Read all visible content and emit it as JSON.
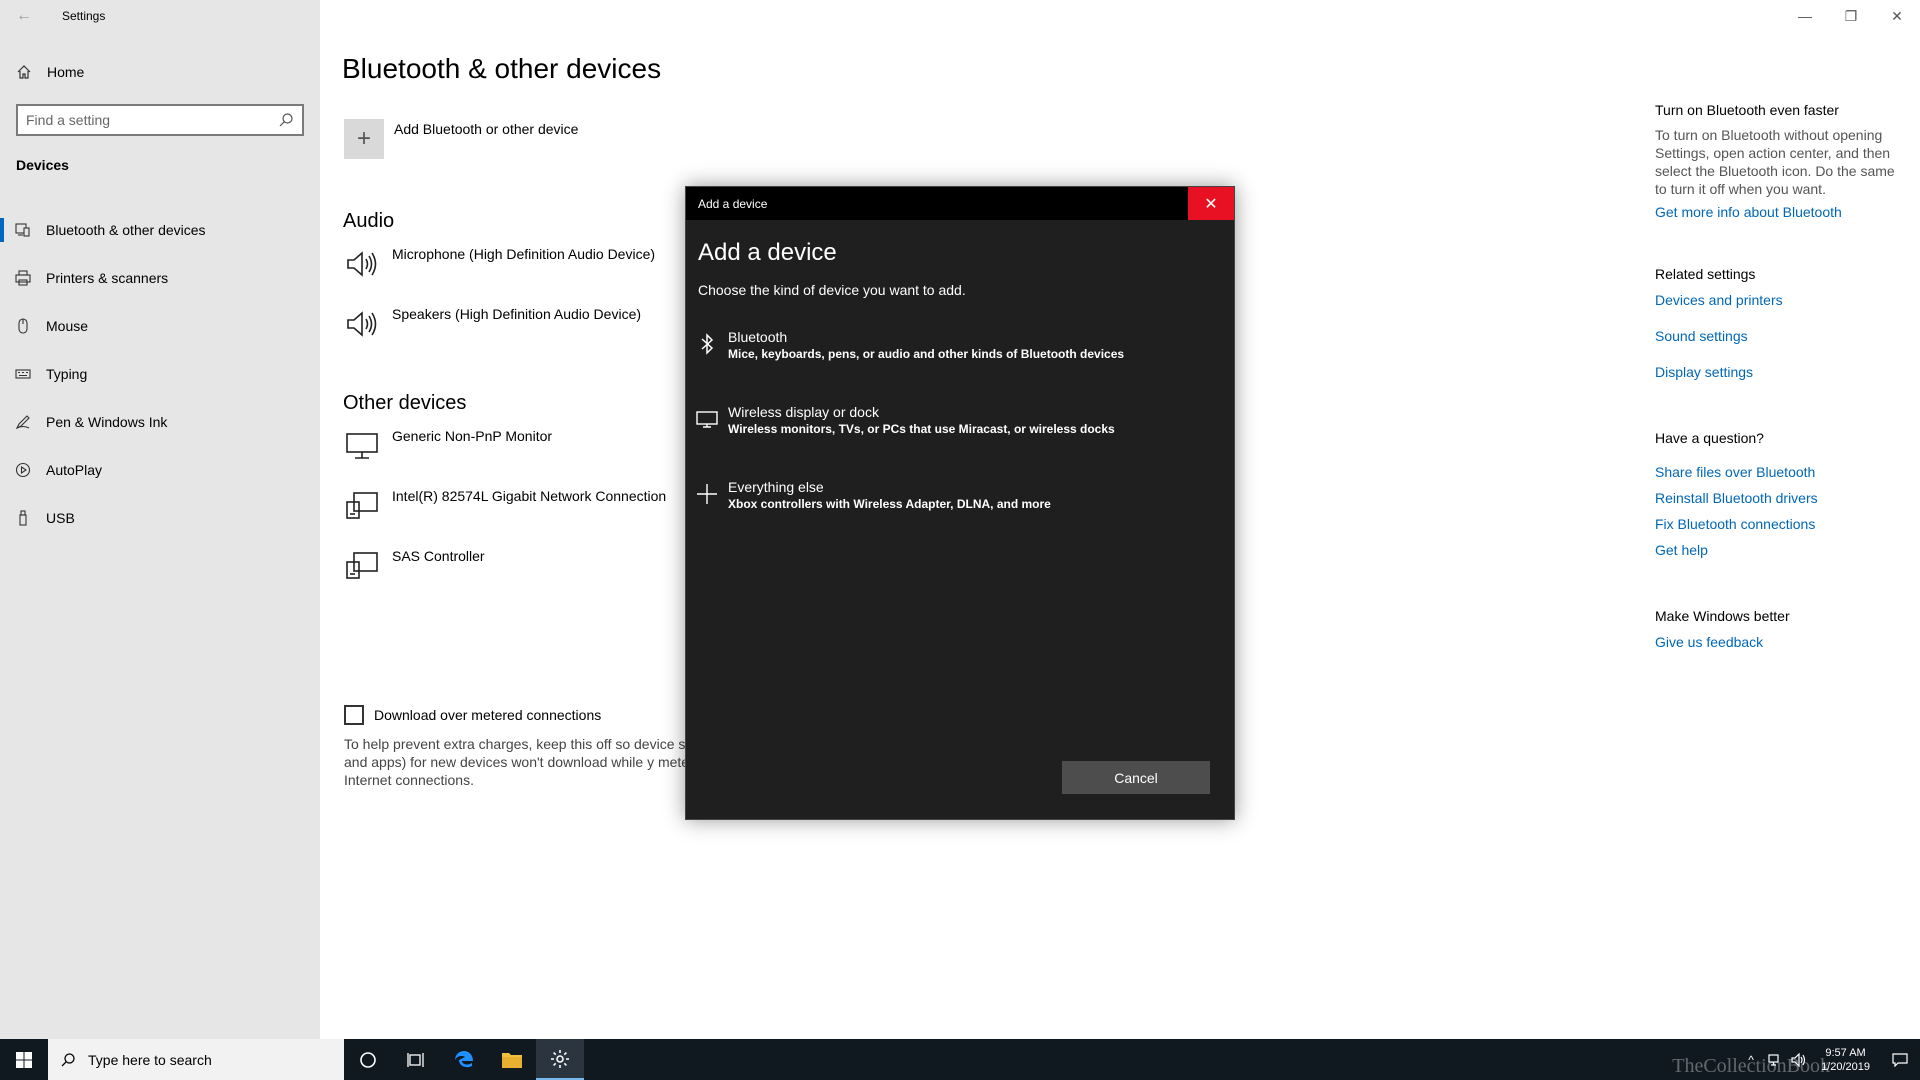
{
  "window": {
    "title": "Settings",
    "back_glyph": "←",
    "minimize_glyph": "—",
    "restore_glyph": "❐",
    "close_glyph": "✕"
  },
  "sidebar": {
    "home_label": "Home",
    "search_placeholder": "Find a setting",
    "section_label": "Devices",
    "items": [
      {
        "label": "Bluetooth & other devices",
        "icon": "bluetooth-devices-icon",
        "selected": true
      },
      {
        "label": "Printers & scanners",
        "icon": "printer-icon"
      },
      {
        "label": "Mouse",
        "icon": "mouse-icon"
      },
      {
        "label": "Typing",
        "icon": "keyboard-icon"
      },
      {
        "label": "Pen & Windows Ink",
        "icon": "pen-icon"
      },
      {
        "label": "AutoPlay",
        "icon": "autoplay-icon"
      },
      {
        "label": "USB",
        "icon": "usb-icon"
      }
    ]
  },
  "main": {
    "title": "Bluetooth & other devices",
    "add_device_label": "Add Bluetooth or other device",
    "audio_heading": "Audio",
    "audio_devices": [
      {
        "name": "Microphone (High Definition Audio Device)",
        "icon": "speaker-icon"
      },
      {
        "name": "Speakers (High Definition Audio Device)",
        "icon": "speaker-icon"
      }
    ],
    "other_heading": "Other devices",
    "other_devices": [
      {
        "name": "Generic Non-PnP Monitor",
        "icon": "monitor-icon"
      },
      {
        "name": "Intel(R) 82574L Gigabit Network Connection",
        "icon": "generic-device-icon"
      },
      {
        "name": "SAS Controller",
        "icon": "generic-device-icon"
      }
    ],
    "metered_checkbox_label": "Download over metered connections",
    "metered_checked": false,
    "metered_help": "To help prevent extra charges, keep this off so device sc info, and apps) for new devices won't download while y metered Internet connections."
  },
  "rightpane": {
    "bt_faster_heading": "Turn on Bluetooth even faster",
    "bt_faster_text": "To turn on Bluetooth without opening Settings, open action center, and then select the Bluetooth icon. Do the same to turn it off when you want.",
    "bt_more_info_link": "Get more info about Bluetooth",
    "related_heading": "Related settings",
    "related_links": [
      "Devices and printers",
      "Sound settings",
      "Display settings"
    ],
    "question_heading": "Have a question?",
    "question_links": [
      "Share files over Bluetooth",
      "Reinstall Bluetooth drivers",
      "Fix Bluetooth connections",
      "Get help"
    ],
    "better_heading": "Make Windows better",
    "feedback_link": "Give us feedback"
  },
  "dialog": {
    "titlebar": "Add a device",
    "heading": "Add a device",
    "subtitle": "Choose the kind of device you want to add.",
    "options": [
      {
        "title": "Bluetooth",
        "desc": "Mice, keyboards, pens, or audio and other kinds of Bluetooth devices",
        "icon": "bluetooth-icon"
      },
      {
        "title": "Wireless display or dock",
        "desc": "Wireless monitors, TVs, or PCs that use Miracast, or wireless docks",
        "icon": "monitor-icon"
      },
      {
        "title": "Everything else",
        "desc": "Xbox controllers with Wireless Adapter, DLNA, and more",
        "icon": "plus-icon"
      }
    ],
    "cancel_label": "Cancel",
    "close_glyph": "✕"
  },
  "taskbar": {
    "search_text": "Type here to search",
    "time": "9:57 AM",
    "date": "1/20/2019",
    "watermark": "TheCollectionBook"
  },
  "colors": {
    "accent": "#0067b8",
    "dialog_bg": "#1f1f1f",
    "close_red": "#e81123",
    "sidebar_bg": "#e6e6e6",
    "taskbar_bg": "#101820"
  }
}
